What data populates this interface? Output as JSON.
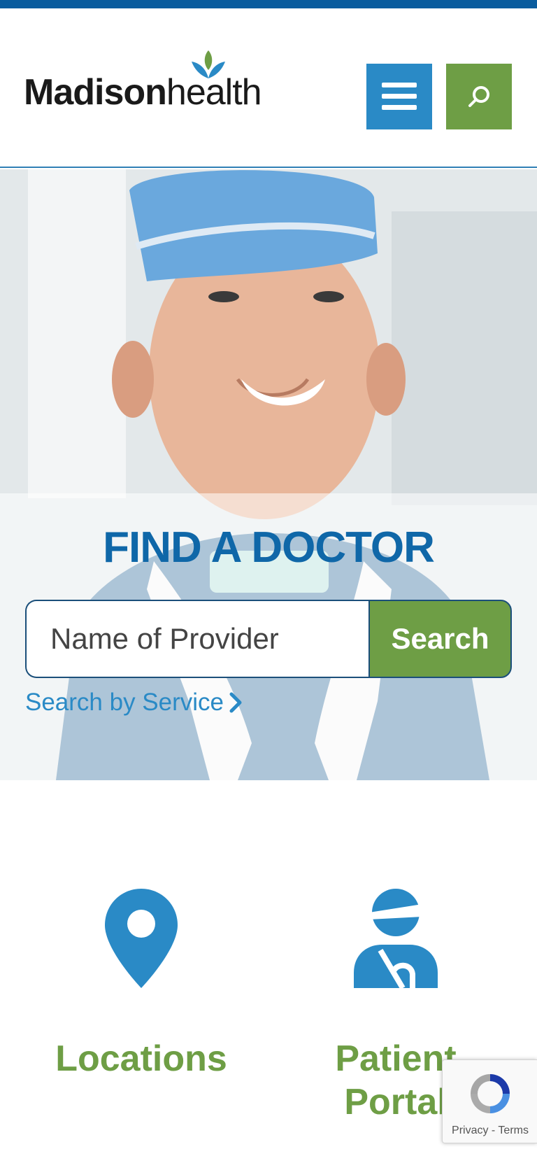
{
  "brand": {
    "logo_bold": "Madison",
    "logo_light": "health",
    "blue": "#2a8ac6",
    "green": "#6e9e45",
    "dark_blue": "#0f67a8"
  },
  "header": {
    "menu_icon": "hamburger-menu-icon",
    "search_icon": "search-icon"
  },
  "hero": {
    "title": "FIND A DOCTOR",
    "input_placeholder": "Name of Provider",
    "search_button": "Search",
    "service_link": "Search by Service"
  },
  "tiles": [
    {
      "label": "Locations",
      "icon": "map-pin-icon"
    },
    {
      "label": "Patient Portal",
      "icon": "patient-icon"
    }
  ],
  "recaptcha": {
    "terms": "Privacy - Terms"
  }
}
